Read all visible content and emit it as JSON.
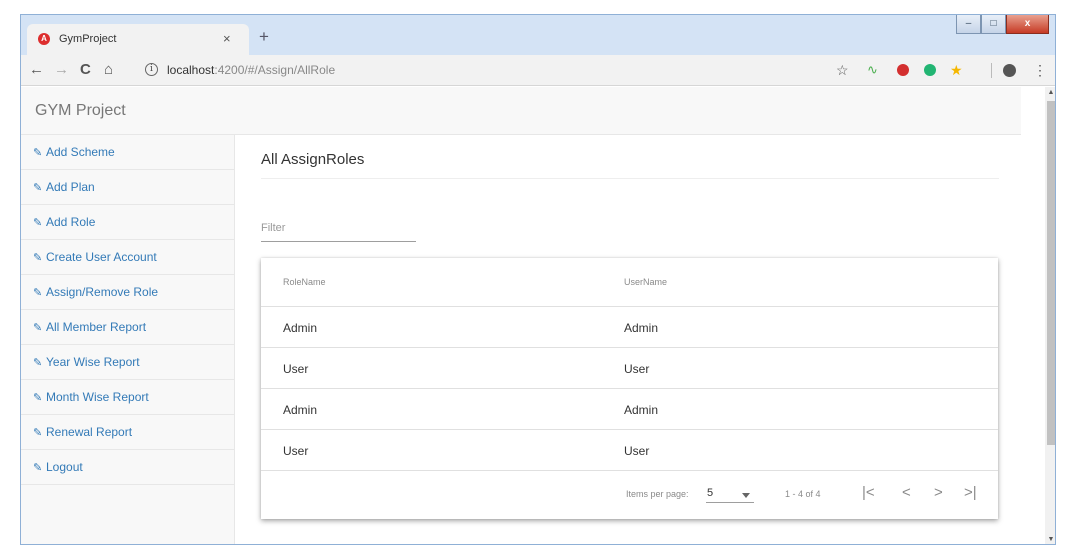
{
  "browser": {
    "tab_title": "GymProject",
    "tab_close": "×",
    "new_tab": "+",
    "url_host": "localhost",
    "url_rest": ":4200/#/Assign/AllRole",
    "win_minimize": "–",
    "win_maximize": "□",
    "win_close": "x",
    "back": "←",
    "forward": "→",
    "reload": "C",
    "home": "⌂",
    "info": "i",
    "star": "☆",
    "menu": "⋮",
    "extension_icons": [
      "star-icon",
      "arrow-extension-icon",
      "adblock-icon",
      "green-extension-icon",
      "yellow-star-extension-icon",
      "profile-icon"
    ]
  },
  "app": {
    "brand": "GYM Project"
  },
  "sidebar": {
    "edit_icon": "✎",
    "items": [
      {
        "label": "Add Scheme"
      },
      {
        "label": "Add Plan"
      },
      {
        "label": "Add Role"
      },
      {
        "label": "Create User Account"
      },
      {
        "label": "Assign/Remove Role"
      },
      {
        "label": "All Member Report"
      },
      {
        "label": "Year Wise Report"
      },
      {
        "label": "Month Wise Report"
      },
      {
        "label": "Renewal Report"
      },
      {
        "label": "Logout"
      }
    ]
  },
  "main": {
    "title": "All AssignRoles",
    "filter_placeholder": "Filter"
  },
  "table": {
    "columns": [
      "RoleName",
      "UserName"
    ],
    "rows": [
      [
        "Admin",
        "Admin"
      ],
      [
        "User",
        "User"
      ],
      [
        "Admin",
        "Admin"
      ],
      [
        "User",
        "User"
      ]
    ]
  },
  "paginator": {
    "items_per_page_label": "Items per page:",
    "page_size": "5",
    "range_label": "1 - 4 of 4",
    "first": "|<",
    "prev": "<",
    "next": ">",
    "last": ">|"
  },
  "colors": {
    "link": "#337ab7",
    "navbar_bg": "#f8f8f8",
    "titlebar": "#d4e3f5"
  }
}
